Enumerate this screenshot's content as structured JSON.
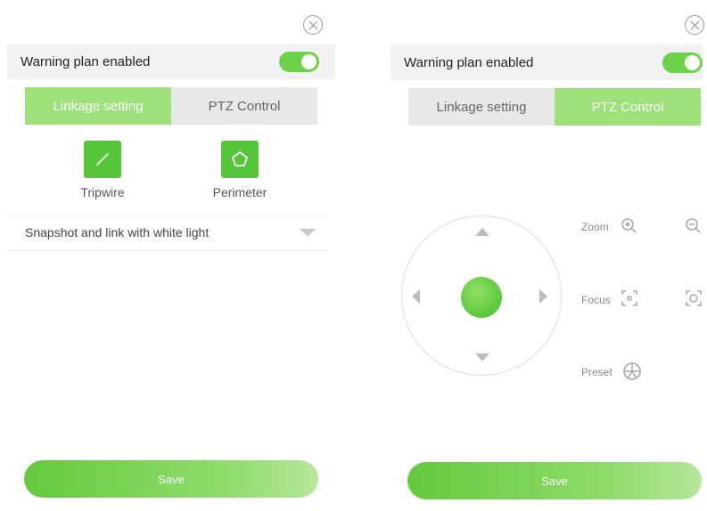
{
  "left_panel": {
    "warning_label": "Warning plan enabled",
    "tabs": [
      {
        "label": "Linkage setting",
        "active": true
      },
      {
        "label": "PTZ Control",
        "active": false
      }
    ],
    "linkage_items": [
      {
        "label": "Tripwire",
        "icon": "tripwire-icon"
      },
      {
        "label": "Perimeter",
        "icon": "perimeter-icon"
      }
    ],
    "dropdown_value": "Snapshot and link with white light",
    "save_label": "Save"
  },
  "right_panel": {
    "warning_label": "Warning plan enabled",
    "tabs": [
      {
        "label": "Linkage setting",
        "active": false
      },
      {
        "label": "PTZ Control",
        "active": true
      }
    ],
    "controls": {
      "zoom_label": "Zoom",
      "focus_label": "Focus",
      "preset_label": "Preset"
    },
    "save_label": "Save"
  },
  "colors": {
    "accent": "#55c53a",
    "tab_active": "#9ee07a",
    "tab_inactive": "#e8e8e8",
    "row_bg": "#f2f2f2"
  }
}
